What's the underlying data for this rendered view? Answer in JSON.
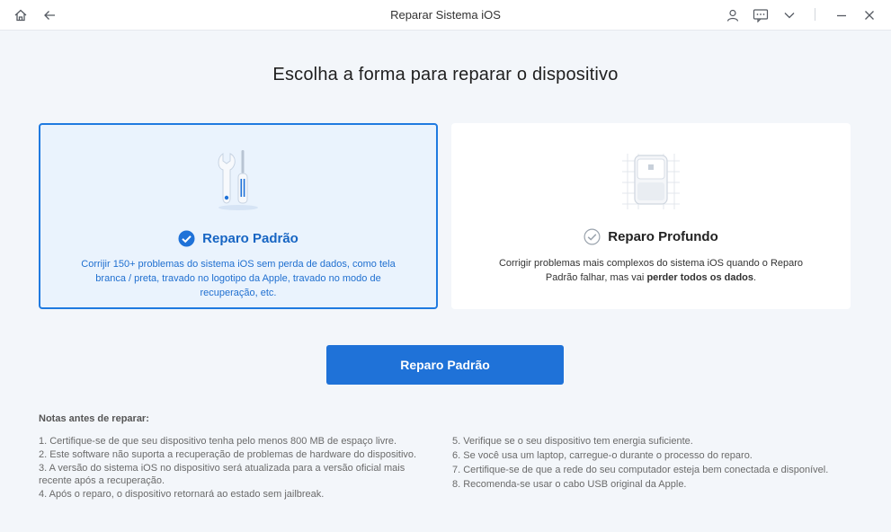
{
  "window": {
    "title": "Reparar Sistema iOS"
  },
  "heading": "Escolha a forma para reparar o dispositivo",
  "cards": {
    "standard": {
      "title": "Reparo Padrão",
      "description": "Corrijir 150+ problemas do sistema iOS sem perda de dados, como tela branca / preta, travado no logotipo da Apple, travado no modo de recuperação, etc.",
      "selected": true
    },
    "deep": {
      "title": "Reparo Profundo",
      "description_prefix": "Corrigir problemas mais complexos do sistema iOS quando o Reparo Padrão falhar, mas vai ",
      "description_bold": "perder todos os dados",
      "description_suffix": ".",
      "selected": false
    }
  },
  "primary_button": "Reparo Padrão",
  "notes": {
    "title": "Notas antes de reparar:",
    "left": [
      "1.  Certifique-se de que seu dispositivo tenha pelo menos 800 MB de espaço livre.",
      "2.  Este software não suporta a recuperação de problemas de hardware do dispositivo.",
      "3.  A versão do sistema iOS no dispositivo será atualizada para a versão oficial mais recente após a recuperação.",
      "4.  Após o reparo, o dispositivo retornará ao estado sem jailbreak."
    ],
    "right": [
      "5.  Verifique se o seu dispositivo tem energia suficiente.",
      "6.  Se você usa um laptop, carregue-o durante o processo do reparo.",
      "7.  Certifique-se de que a rede do seu computador esteja bem conectada e disponível.",
      "8.  Recomenda-se usar o cabo USB original da Apple."
    ]
  },
  "colors": {
    "accent": "#1f72d8",
    "selected_bg": "#eaf3fd",
    "selected_border": "#1f7ae0",
    "page_bg": "#f3f6fa"
  },
  "icons": [
    "home-icon",
    "back-arrow-icon",
    "user-icon",
    "feedback-icon",
    "menu-chevron-icon",
    "minimize-icon",
    "close-icon",
    "check-circle-icon",
    "tools-icon",
    "device-icon"
  ]
}
